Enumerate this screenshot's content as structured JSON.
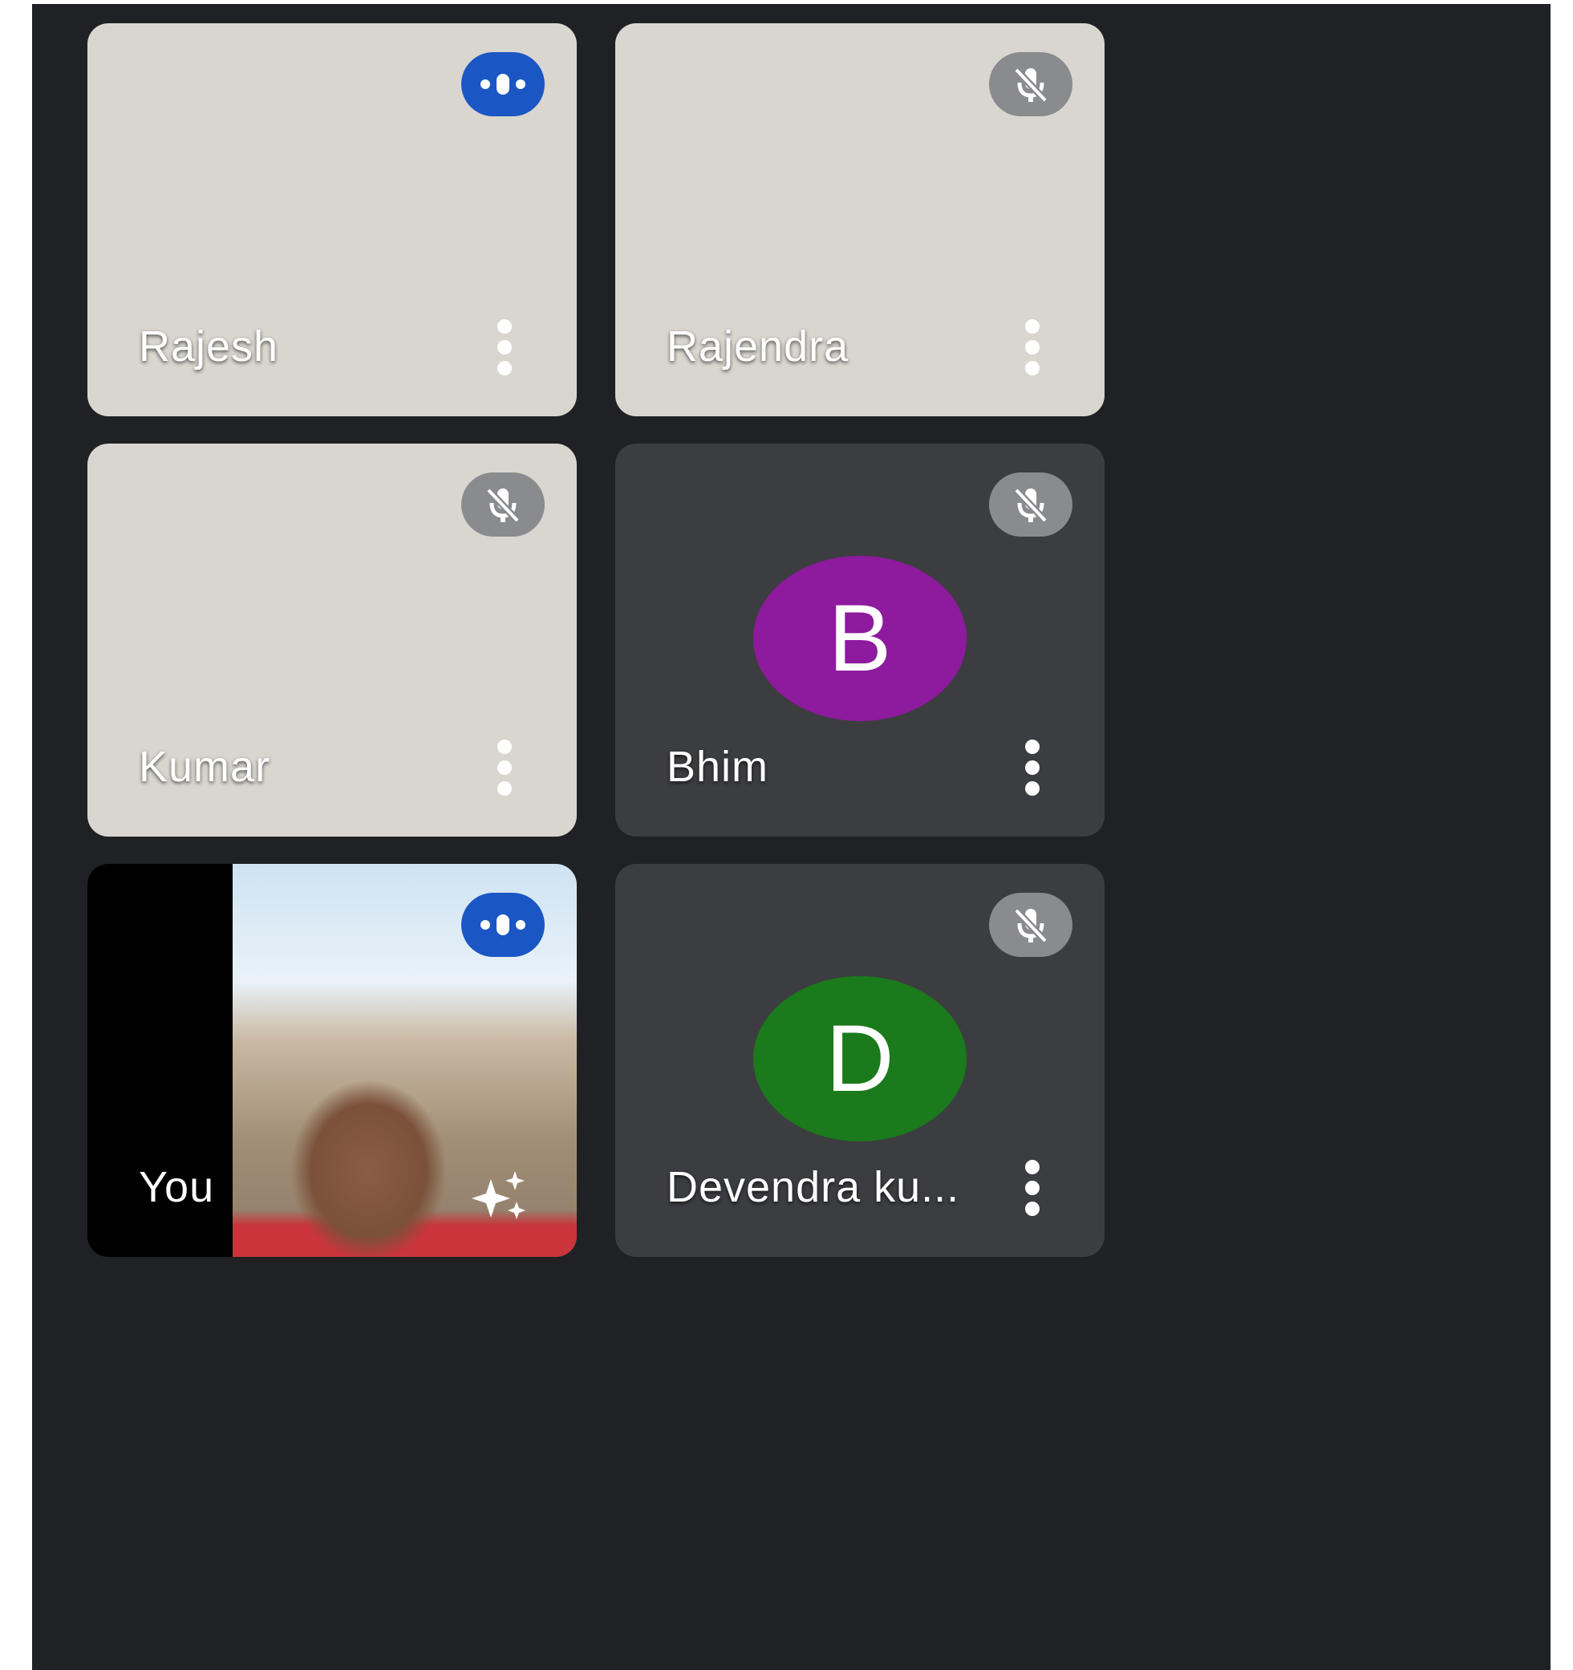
{
  "participants": [
    {
      "name": "Rajesh",
      "status": "speaking",
      "menu_icon": "more-vert-icon"
    },
    {
      "name": "Rajendra",
      "status": "muted",
      "menu_icon": "more-vert-icon"
    },
    {
      "name": "Kumar",
      "status": "muted",
      "menu_icon": "more-vert-icon"
    },
    {
      "name": "Bhim",
      "status": "muted",
      "avatar_letter": "B",
      "avatar_color": "#8e1a9e",
      "menu_icon": "more-vert-icon"
    },
    {
      "name": "You",
      "status": "speaking",
      "effects_icon": "sparkle-effects-icon"
    },
    {
      "name": "Devendra ku...",
      "status": "muted",
      "avatar_letter": "D",
      "avatar_color": "#1b7a1b",
      "menu_icon": "more-vert-icon"
    }
  ],
  "colors": {
    "background": "#202124",
    "tile_dark": "#3c3d40",
    "speaking_badge": "#1a56c4",
    "muted_badge": "#8a8b8e"
  }
}
